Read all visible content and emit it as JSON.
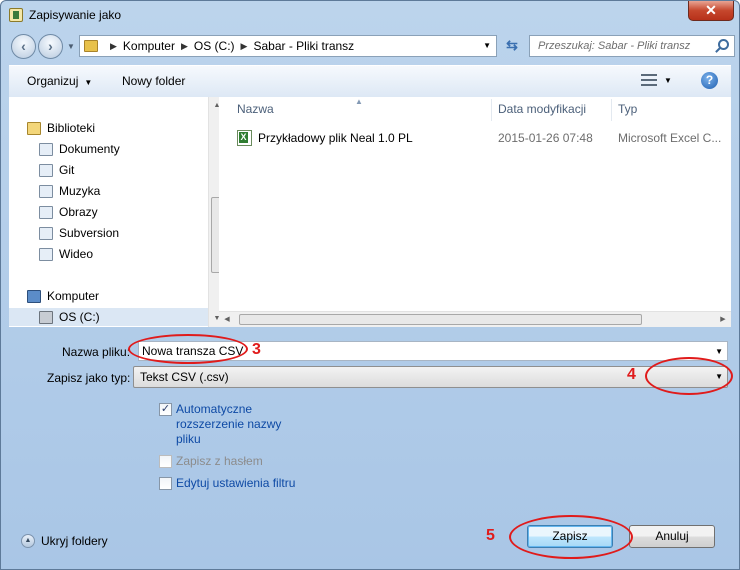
{
  "window": {
    "title": "Zapisywanie jako",
    "close_glyph": "✕"
  },
  "address": {
    "crumbs": [
      "Komputer",
      "OS (C:)",
      "Sabar - Pliki transz"
    ]
  },
  "search": {
    "placeholder": "Przeszukaj: Sabar - Pliki transz"
  },
  "toolbar": {
    "organize": "Organizuj",
    "new_folder": "Nowy folder",
    "help": "?"
  },
  "nav": {
    "items": [
      {
        "label": "Biblioteki",
        "icon": "library-icon"
      },
      {
        "label": "Dokumenty",
        "icon": "documents-icon"
      },
      {
        "label": "Git",
        "icon": "git-folder-icon"
      },
      {
        "label": "Muzyka",
        "icon": "music-icon"
      },
      {
        "label": "Obrazy",
        "icon": "pictures-icon"
      },
      {
        "label": "Subversion",
        "icon": "subversion-folder-icon"
      },
      {
        "label": "Wideo",
        "icon": "video-icon"
      },
      {
        "label": "Komputer",
        "icon": "computer-icon"
      },
      {
        "label": "OS (C:)",
        "icon": "drive-icon"
      }
    ]
  },
  "files": {
    "columns": [
      "Nazwa",
      "Data modyfikacji",
      "Typ"
    ],
    "rows": [
      {
        "name": "Przykładowy plik Neal 1.0 PL",
        "date": "2015-01-26 07:48",
        "type": "Microsoft Excel C..."
      }
    ]
  },
  "form": {
    "filename_label": "Nazwa pliku:",
    "filename_value": "Nowa transza CSV",
    "filetype_label": "Zapisz jako typ:",
    "filetype_value": "Tekst CSV (.csv)",
    "options": [
      {
        "label": "Automatyczne rozszerzenie nazwy pliku",
        "checked": true,
        "enabled": true
      },
      {
        "label": "Zapisz z hasłem",
        "checked": false,
        "enabled": false
      },
      {
        "label": "Edytuj ustawienia filtru",
        "checked": false,
        "enabled": true
      }
    ]
  },
  "footer": {
    "hide_folders": "Ukryj foldery",
    "save": "Zapisz",
    "cancel": "Anuluj"
  },
  "annotations": {
    "n3": "3",
    "n4": "4",
    "n5": "5"
  },
  "colors": {
    "annotation": "#e01b1b",
    "link_blue": "#0e4aa5"
  }
}
